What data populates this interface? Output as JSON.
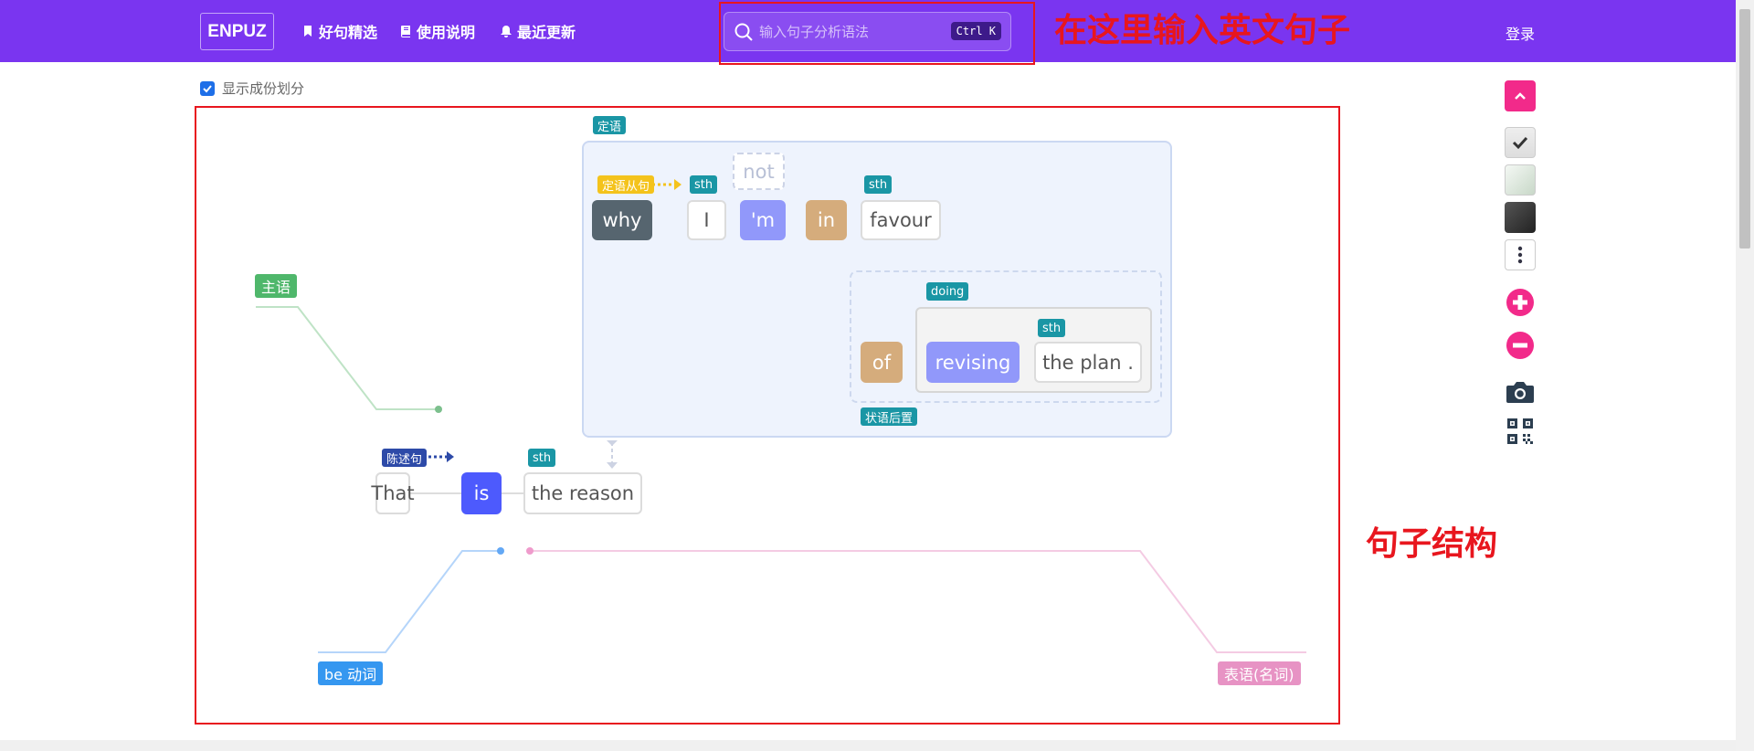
{
  "header": {
    "logo": "ENPUZ",
    "nav": [
      {
        "label": "好句精选",
        "icon": "bookmark-icon"
      },
      {
        "label": "使用说明",
        "icon": "book-icon"
      },
      {
        "label": "最近更新",
        "icon": "bell-icon"
      }
    ],
    "search_placeholder": "输入句子分析语法",
    "search_shortcut": "Ctrl K",
    "login": "登录"
  },
  "annotations": {
    "search_hint": "在这里输入英文句子",
    "structure_hint": "句子结构"
  },
  "options": {
    "show_components_label": "显示成份划分",
    "show_components_checked": true
  },
  "diagram": {
    "sentence_type": "陈述句",
    "main": {
      "subject": "That",
      "verb": "is",
      "object": "the reason",
      "object_tag": "sth"
    },
    "attributive": {
      "tag": "定语",
      "clause_tag": "定语从句",
      "relative": "why",
      "subject": "I",
      "subject_tag": "sth",
      "negation": "not",
      "verb": "'m",
      "preposition": "in",
      "object": "favour",
      "object_tag": "sth"
    },
    "postposed_adverbial": {
      "tag": "状语后置",
      "preposition": "of",
      "gerund_tag": "doing",
      "gerund": "revising",
      "object": "the plan .",
      "object_tag": "sth"
    },
    "component_labels": {
      "subject": "主语",
      "be_verb": "be 动词",
      "predicative": "表语(名词)"
    }
  },
  "colors": {
    "header": "#7a35f0",
    "annotation": "#e8161e",
    "teal_tag": "#1a96a5",
    "subject_label": "#4fb76b",
    "be_verb_label": "#3597f0",
    "predicative_label": "#e793c4",
    "verb_box": "#4d5afd",
    "clause_verb_box": "#9198fa",
    "preposition_box": "#d5ac7c",
    "relative_box": "#56656f",
    "clause_tag": "#f4c31c",
    "statement_tag": "#2d4aa8",
    "tool_pink": "#f22a8a"
  },
  "toolbar": [
    {
      "name": "scroll-top-icon"
    },
    {
      "name": "check-theme-icon"
    },
    {
      "name": "light-theme-icon"
    },
    {
      "name": "dark-theme-icon"
    },
    {
      "name": "more-icon"
    },
    {
      "name": "zoom-in-icon"
    },
    {
      "name": "zoom-out-icon"
    },
    {
      "name": "camera-icon"
    },
    {
      "name": "qrcode-icon"
    }
  ]
}
